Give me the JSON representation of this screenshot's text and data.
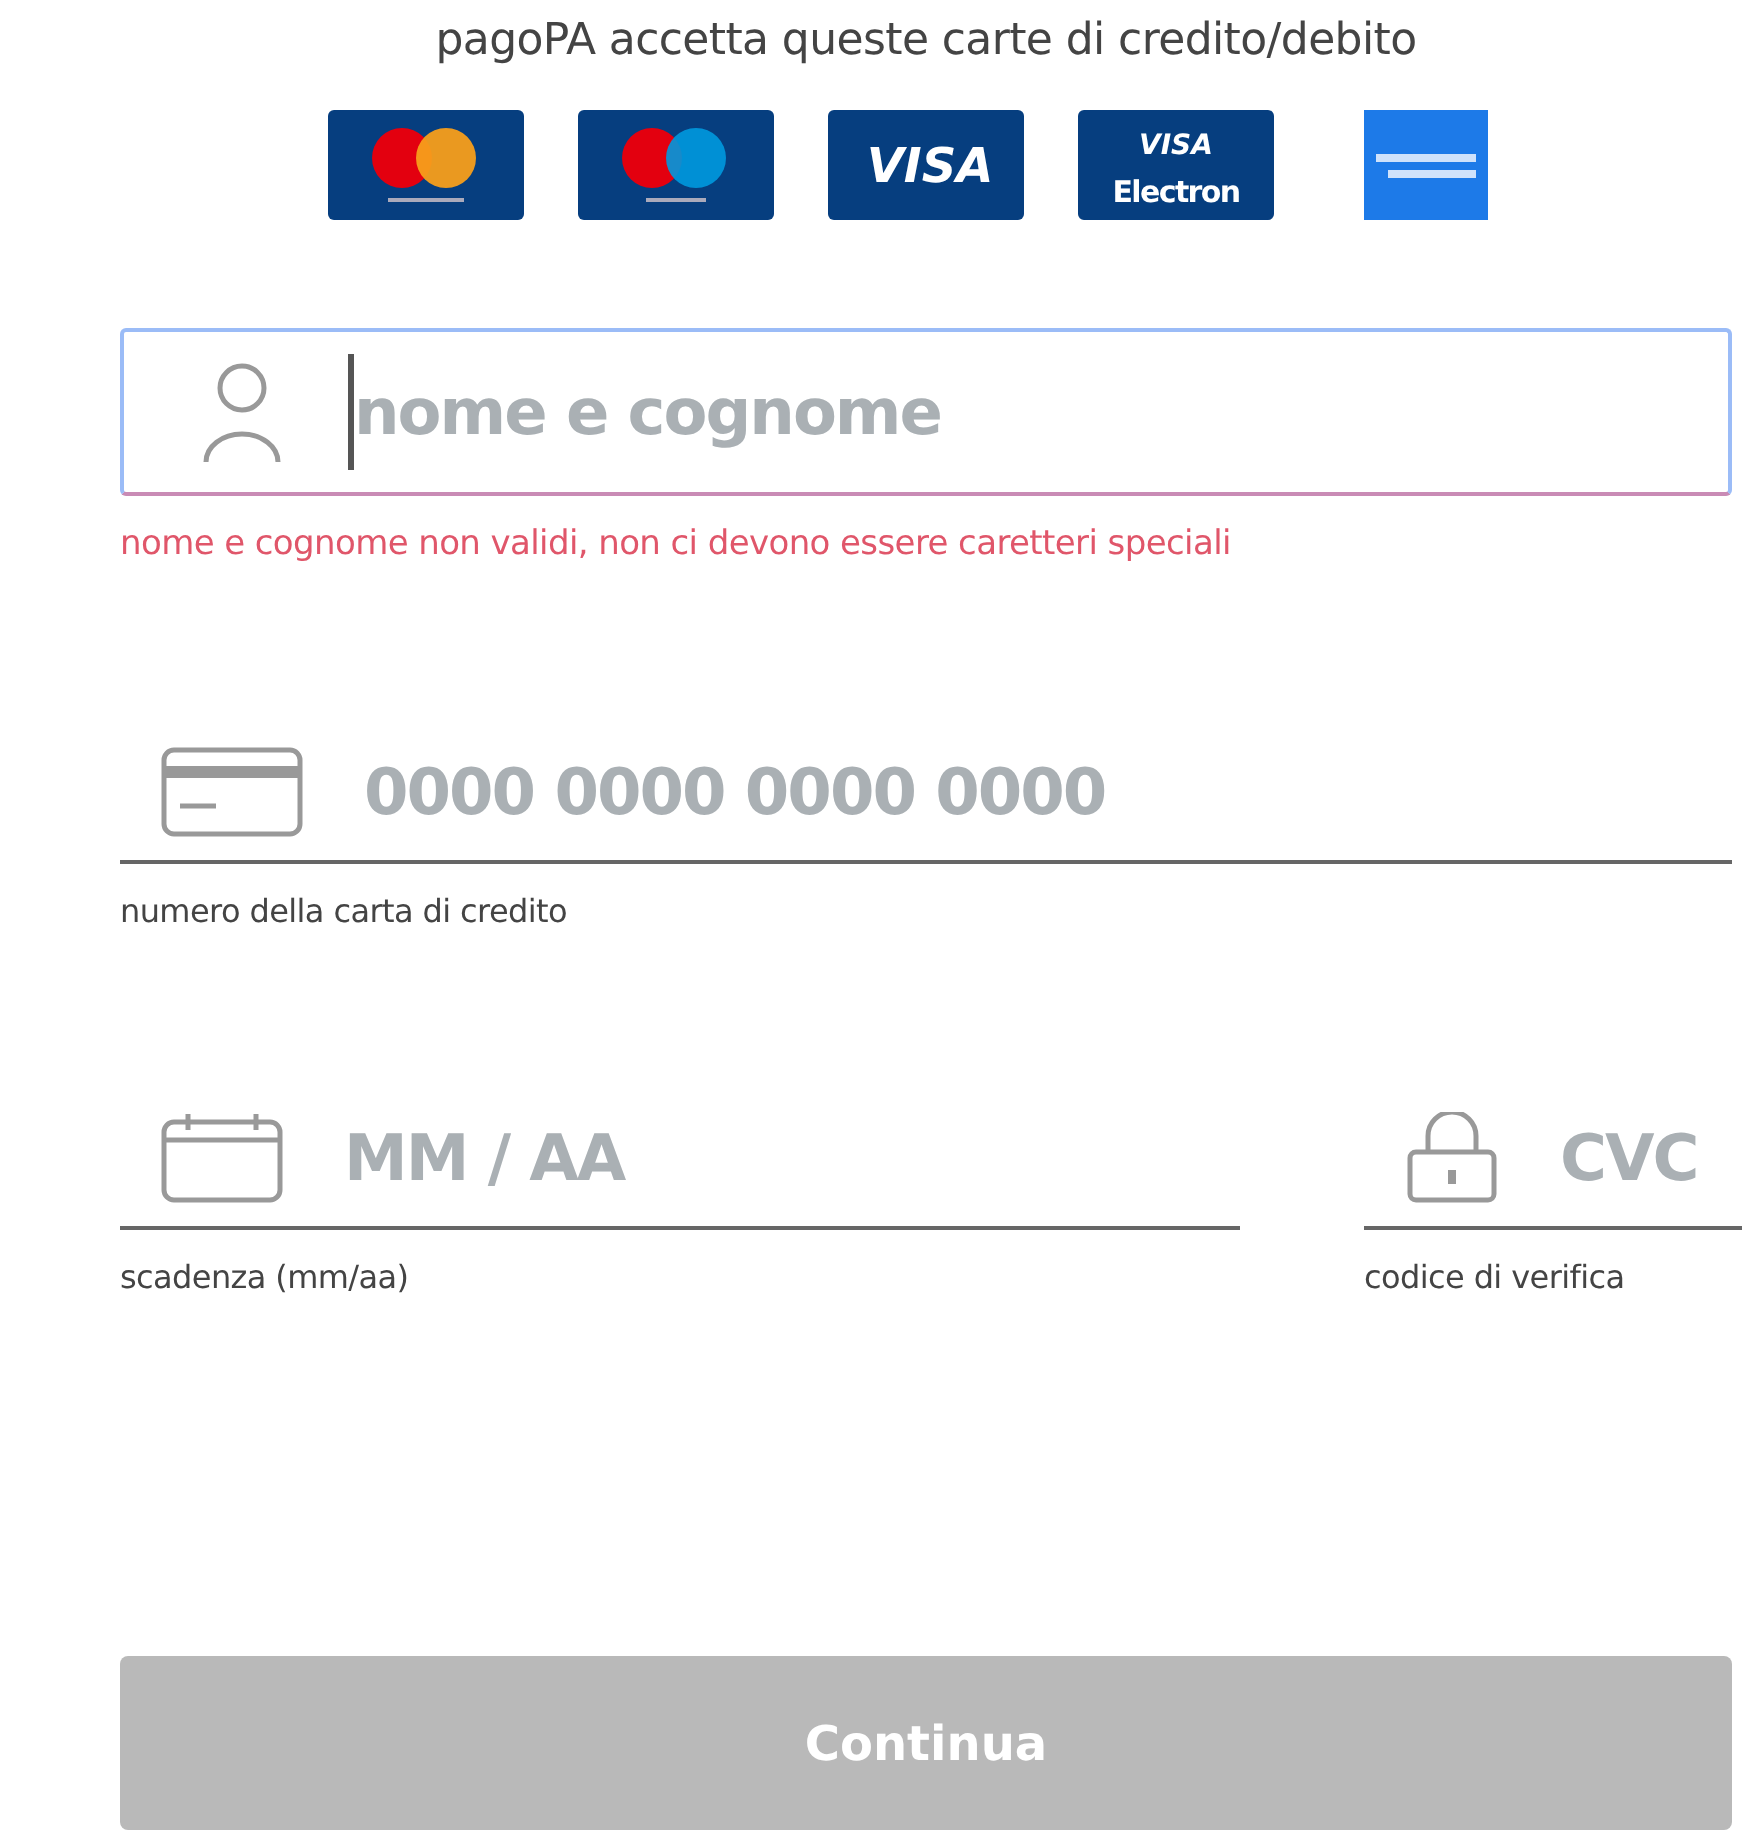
{
  "heading": "pagoPA accetta queste carte di credito/debito",
  "cards": [
    {
      "kind": "mastercard"
    },
    {
      "kind": "maestro"
    },
    {
      "kind": "visa",
      "label": "VISA"
    },
    {
      "kind": "electron",
      "label": "VISA",
      "sublabel": "Electron"
    },
    {
      "kind": "amex"
    }
  ],
  "fields": [
    {
      "kind": "name",
      "placeholder": "nome e cognome",
      "focused": true,
      "error": "nome e cognome non validi, non ci devono essere caretteri speciali"
    },
    {
      "kind": "card",
      "placeholder": "0000 0000 0000 0000",
      "focused": false,
      "helper": "numero della carta di credito"
    }
  ],
  "row_fields": [
    {
      "kind": "date",
      "placeholder": "MM / AA",
      "focused": false,
      "helper": "scadenza (mm/aa)"
    },
    {
      "kind": "lock",
      "placeholder": "CVC",
      "focused": false,
      "helper": "codice di verifica"
    }
  ],
  "button": {
    "label": "Continua",
    "disabled": true
  }
}
